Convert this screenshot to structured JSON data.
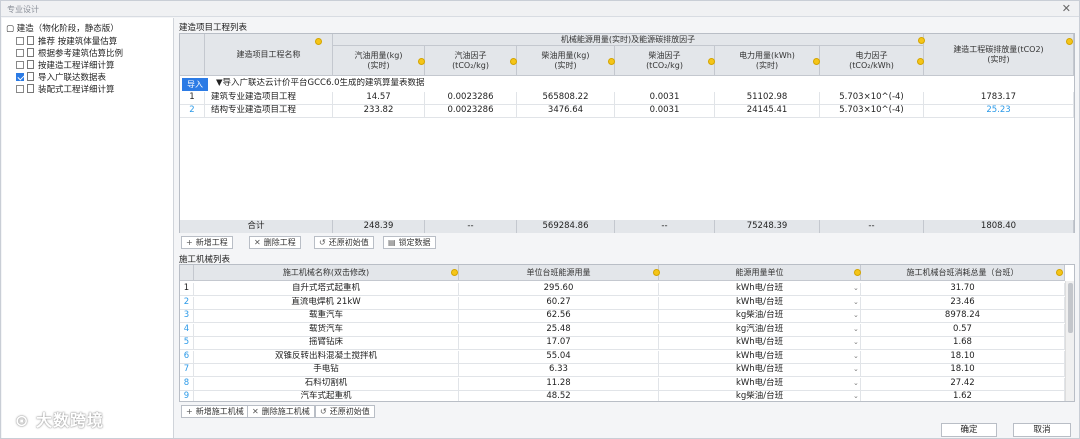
{
  "window": {
    "title": "专业设计",
    "close": "✕"
  },
  "tree": {
    "root": "▢ 建造（物化阶段，静态版）",
    "items": [
      {
        "label": "推荐  按建筑体量估算",
        "checked": false
      },
      {
        "label": "根据参考建筑估算比例",
        "checked": false
      },
      {
        "label": "按建造工程详细计算",
        "checked": false
      },
      {
        "label": "导入广联达数据表",
        "checked": true
      },
      {
        "label": "装配式工程详细计算",
        "checked": false
      }
    ]
  },
  "top": {
    "section": "建造项目工程列表",
    "group_header": "机械能源用量(实时)及能源碳排放因子",
    "headers": {
      "name": "建造项目工程名称",
      "gas_use": "汽油用量(kg)\n(实时)",
      "gas_factor": "汽油因子\n(tCO₂/kg)",
      "diesel_use": "柴油用量(kg)\n(实时)",
      "diesel_factor": "柴油因子\n(tCO₂/kg)",
      "power_use": "电力用量(kWh)\n(实时)",
      "power_factor": "电力因子\n(tCO₂/kWh)",
      "total": "建造工程碳排放量(tCO2)\n(实时)"
    },
    "import_btn": "导入",
    "import_note": "▼导入广联达云计价平台GCC6.0生成的建筑算量表数据",
    "rows": [
      {
        "n": "1",
        "name": "建筑专业建造项目工程",
        "gas": "14.57",
        "gasf": "0.0023286",
        "diesel": "565808.22",
        "dieself": "0.0031",
        "power": "51102.98",
        "powerf": "5.703×10^(-4)",
        "total": "1783.17"
      },
      {
        "n": "2",
        "name": "结构专业建造项目工程",
        "gas": "233.82",
        "gasf": "0.0023286",
        "diesel": "3476.64",
        "dieself": "0.0031",
        "power": "24145.41",
        "powerf": "5.703×10^(-4)",
        "total": "25.23"
      }
    ],
    "footer": {
      "label": "合计",
      "gas": "248.39",
      "gasf": "--",
      "diesel": "569284.86",
      "dieself": "--",
      "power": "75248.39",
      "powerf": "--",
      "total": "1808.40"
    },
    "buttons": {
      "add": "新增工程",
      "del": "删除工程",
      "restore": "还原初始值",
      "lock": "锁定数据"
    }
  },
  "bottom": {
    "section": "施工机械列表",
    "headers": {
      "name": "施工机械名称(双击修改)",
      "use": "单位台班能源用量",
      "unit": "能源用量单位",
      "total": "施工机械台班消耗总量（台班）"
    },
    "rows": [
      {
        "n": "1",
        "name": "自升式塔式起重机",
        "use": "295.60",
        "unit": "kWh电/台班",
        "total": "31.70"
      },
      {
        "n": "2",
        "name": "直流电焊机 21kW",
        "use": "60.27",
        "unit": "kWh电/台班",
        "total": "23.46"
      },
      {
        "n": "3",
        "name": "载重汽车",
        "use": "62.56",
        "unit": "kg柴油/台班",
        "total": "8978.24"
      },
      {
        "n": "4",
        "name": "载货汽车",
        "use": "25.48",
        "unit": "kg汽油/台班",
        "total": "0.57"
      },
      {
        "n": "5",
        "name": "摇臂钻床",
        "use": "17.07",
        "unit": "kWh电/台班",
        "total": "1.68"
      },
      {
        "n": "6",
        "name": "双锥反转出料混凝土搅拌机",
        "use": "55.04",
        "unit": "kWh电/台班",
        "total": "18.10"
      },
      {
        "n": "7",
        "name": "手电钻",
        "use": "6.33",
        "unit": "kWh电/台班",
        "total": "18.10"
      },
      {
        "n": "8",
        "name": "石料切割机",
        "use": "11.28",
        "unit": "kWh电/台班",
        "total": "27.42"
      },
      {
        "n": "9",
        "name": "汽车式起重机",
        "use": "48.52",
        "unit": "kg柴油/台班",
        "total": "1.62"
      }
    ],
    "buttons": {
      "add": "新增施工机械",
      "del": "删除施工机械",
      "restore": "还原初始值"
    }
  },
  "dialog": {
    "ok": "确定",
    "cancel": "取消"
  },
  "watermark": "大数跨境"
}
